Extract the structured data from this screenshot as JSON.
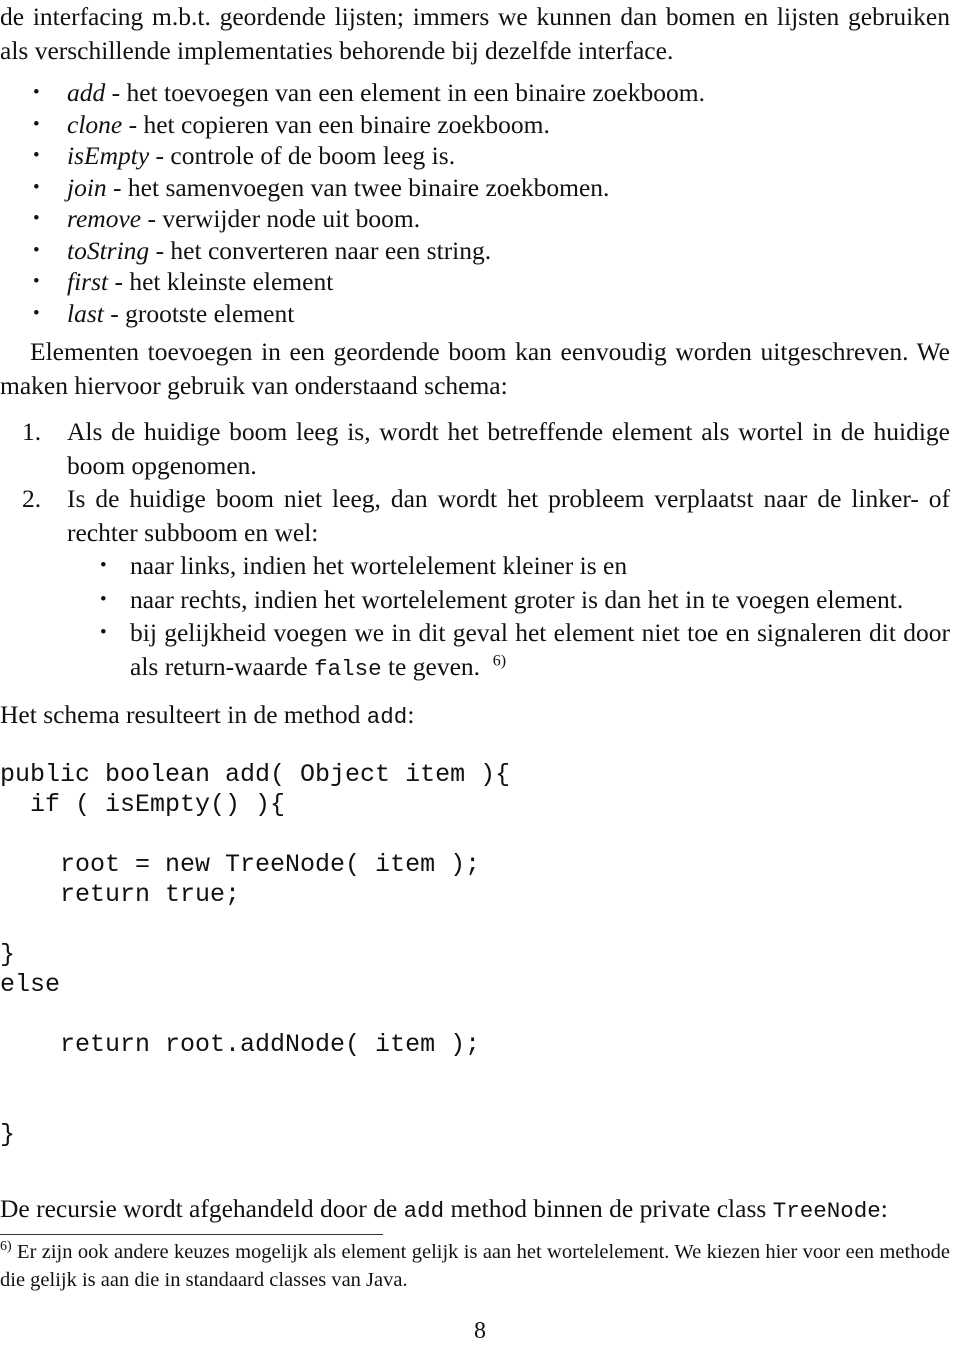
{
  "document": {
    "page_number": "8",
    "language": "nl"
  },
  "intro": {
    "paragraph": "de interfacing m.b.t. geordende lijsten; immers we kunnen dan bomen en lijsten gebruiken als verschillende implementaties behorende bij dezelfde interface."
  },
  "method_list": {
    "bullet_glyph": "•",
    "items": [
      {
        "name": "add",
        "description": "- het toevoegen van een element in een binaire zoekboom."
      },
      {
        "name": "clone",
        "description": "- het copieren van een binaire zoekboom."
      },
      {
        "name": "isEmpty",
        "description": "- controle of de boom leeg is."
      },
      {
        "name": "join",
        "description": "- het samenvoegen van twee binaire zoekbomen."
      },
      {
        "name": "remove",
        "description": "- verwijder node uit boom."
      },
      {
        "name": "toString",
        "description": "- het converteren naar een string."
      },
      {
        "name": "first",
        "description": "- het kleinste element"
      },
      {
        "name": "last",
        "description": "- grootste element"
      }
    ]
  },
  "schema_intro": {
    "paragraph": "Elementen toevoegen in een geordende boom kan eenvoudig worden uitgeschreven. We maken hiervoor gebruik van onderstaand schema:"
  },
  "steps": {
    "item1": {
      "number": "1.",
      "text": "Als de huidige boom leeg is, wordt het betreffende element als wortel in de huidige boom opgenomen."
    },
    "item2": {
      "number": "2.",
      "text": "Is de huidige boom niet leeg, dan wordt het probleem verplaatst naar de linker- of rechter subboom en wel:",
      "bullet_glyph": "•",
      "subitems": [
        {
          "text": "naar links, indien het wortelelement kleiner is en"
        },
        {
          "text": "naar rechts, indien het wortelelement groter is dan het in te voegen element."
        },
        {
          "text_before": "bij gelijkheid voegen we in dit geval het element niet toe en signaleren dit door als return-waarde ",
          "code": "false",
          "text_after": " te geven.",
          "footnote_ref": "6)"
        }
      ]
    }
  },
  "method_intro": {
    "text_before": "Het schema resulteert in de method ",
    "code": "add",
    "text_after": ":"
  },
  "code_block": {
    "language": "java",
    "content": "public boolean add( Object item ){\n  if ( isEmpty() ){\n\n    root = new TreeNode( item );\n    return true;\n\n}\nelse\n\n    return root.addNode( item );\n\n\n}"
  },
  "recursion_note": {
    "text_before": "De recursie wordt afgehandeld door de ",
    "code1": "add",
    "text_middle": " method binnen de private class ",
    "code2": "TreeNode",
    "text_after": ":"
  },
  "footnote": {
    "marker": "6)",
    "text": "Er zijn ook andere keuzes mogelijk als element gelijk is aan het wortelelement. We kiezen hier voor een methode die gelijk is aan die in standaard classes van Java."
  }
}
